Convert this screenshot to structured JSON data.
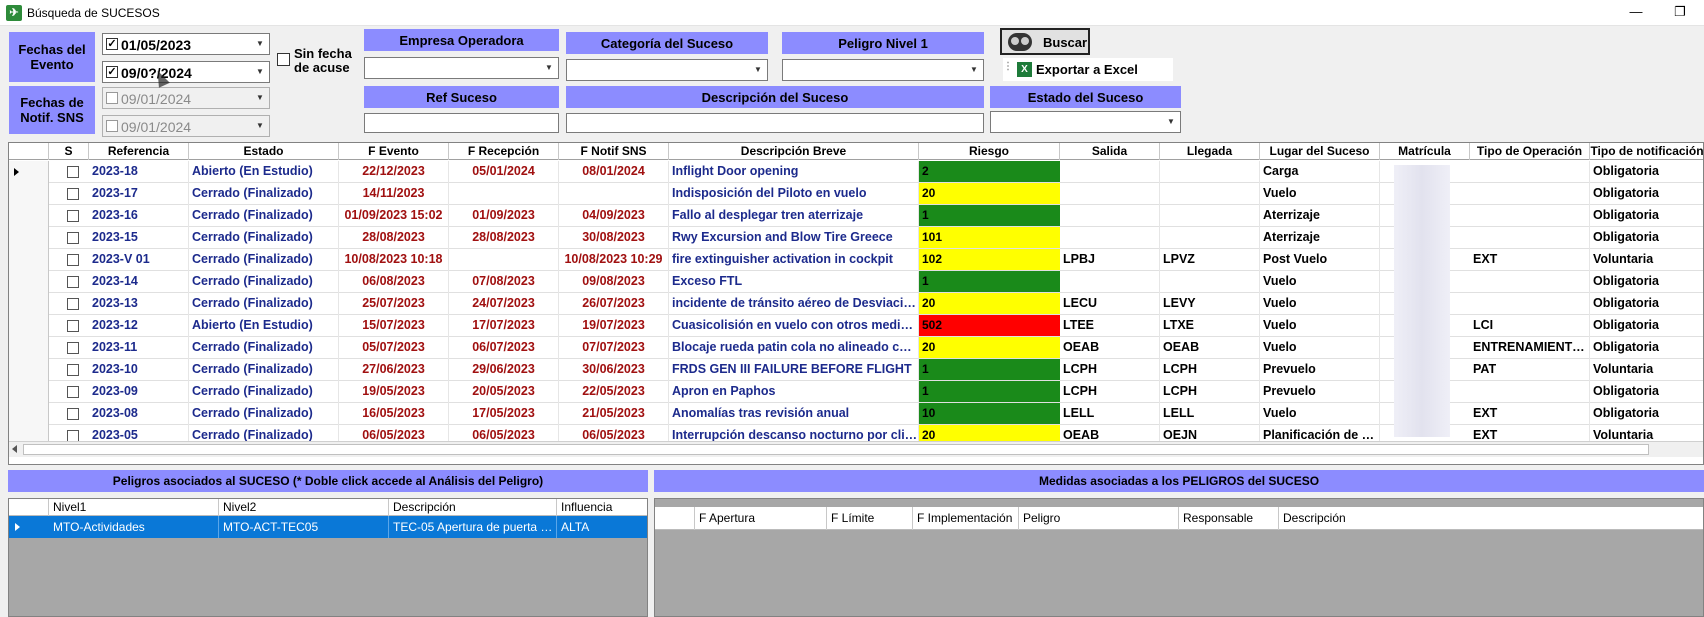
{
  "window": {
    "title": "Búsqueda de SUCESOS",
    "app_icon": "airplane-icon",
    "minimize": "—",
    "restore": "❐"
  },
  "filters": {
    "fechas_evento_label": "Fechas del Evento",
    "fechas_notif_label": "Fechas de Notif. SNS",
    "evento_desde": "01/05/2023",
    "evento_hasta": "09/0?/2024",
    "notif_desde": "09/01/2024",
    "notif_hasta": "09/01/2024",
    "sin_fecha_acuse": "Sin fecha de acuse",
    "empresa_operadora": "Empresa Operadora",
    "categoria_suceso": "Categoría del Suceso",
    "peligro_nivel1": "Peligro Nivel 1",
    "ref_suceso": "Ref Suceso",
    "descripcion_suceso": "Descripción del Suceso",
    "estado_suceso": "Estado del Suceso",
    "buscar": "Buscar",
    "exportar_excel": "Exportar a Excel"
  },
  "colors": {
    "accent": "#8c8cff",
    "riesgo_green": "#1a8a1a",
    "riesgo_yellow": "#ffff00",
    "riesgo_red": "#ff0000",
    "selected_row": "#0a78d7"
  },
  "grid": {
    "columns": [
      "S",
      "Referencia",
      "Estado",
      "F Evento",
      "F Recepción",
      "F Notif SNS",
      "Descripción Breve",
      "Riesgo",
      "Salida",
      "Llegada",
      "Lugar del Suceso",
      "Matrícula",
      "Tipo de Operación",
      "Tipo de notificación"
    ],
    "rows": [
      {
        "ref": "2023-18",
        "estado": "Abierto (En Estudio)",
        "f_evento": "22/12/2023",
        "f_recepcion": "05/01/2024",
        "f_notif": "08/01/2024",
        "descripcion": "Inflight Door opening",
        "riesgo": "2",
        "riesgo_color": "green",
        "salida": "",
        "llegada": "",
        "lugar": "Carga",
        "tipo_op": "",
        "tipo_notif": "Obligatoria"
      },
      {
        "ref": "2023-17",
        "estado": "Cerrado (Finalizado)",
        "f_evento": "14/11/2023",
        "f_recepcion": "",
        "f_notif": "",
        "descripcion": "Indisposición del Piloto en vuelo",
        "riesgo": "20",
        "riesgo_color": "yellow",
        "salida": "",
        "llegada": "",
        "lugar": "Vuelo",
        "tipo_op": "",
        "tipo_notif": "Obligatoria"
      },
      {
        "ref": "2023-16",
        "estado": "Cerrado (Finalizado)",
        "f_evento": "01/09/2023 15:02",
        "f_recepcion": "01/09/2023",
        "f_notif": "04/09/2023",
        "descripcion": "Fallo al desplegar tren aterrizaje",
        "riesgo": "1",
        "riesgo_color": "green",
        "salida": "",
        "llegada": "",
        "lugar": "Aterrizaje",
        "tipo_op": "",
        "tipo_notif": "Obligatoria"
      },
      {
        "ref": "2023-15",
        "estado": "Cerrado (Finalizado)",
        "f_evento": "28/08/2023",
        "f_recepcion": "28/08/2023",
        "f_notif": "30/08/2023",
        "descripcion": "Rwy Excursion and Blow Tire Greece",
        "riesgo": "101",
        "riesgo_color": "yellow",
        "salida": "",
        "llegada": "",
        "lugar": "Aterrizaje",
        "tipo_op": "",
        "tipo_notif": "Obligatoria"
      },
      {
        "ref": "2023-V 01",
        "estado": "Cerrado (Finalizado)",
        "f_evento": "10/08/2023 10:18",
        "f_recepcion": "",
        "f_notif": "10/08/2023 10:29",
        "descripcion": "fire extinguisher activation in cockpit",
        "riesgo": "102",
        "riesgo_color": "yellow",
        "salida": "LPBJ",
        "llegada": "LPVZ",
        "lugar": "Post Vuelo",
        "tipo_op": "EXT",
        "tipo_notif": "Voluntaria"
      },
      {
        "ref": "2023-14",
        "estado": "Cerrado (Finalizado)",
        "f_evento": "06/08/2023",
        "f_recepcion": "07/08/2023",
        "f_notif": "09/08/2023",
        "descripcion": "Exceso FTL",
        "riesgo": "1",
        "riesgo_color": "green",
        "salida": "",
        "llegada": "",
        "lugar": "Vuelo",
        "tipo_op": "",
        "tipo_notif": "Obligatoria"
      },
      {
        "ref": "2023-13",
        "estado": "Cerrado (Finalizado)",
        "f_evento": "25/07/2023",
        "f_recepcion": "24/07/2023",
        "f_notif": "26/07/2023",
        "descripcion": "incidente de tránsito aéreo de Desviació...",
        "riesgo": "20",
        "riesgo_color": "yellow",
        "salida": "LECU",
        "llegada": "LEVY",
        "lugar": "Vuelo",
        "tipo_op": "",
        "tipo_notif": "Obligatoria"
      },
      {
        "ref": "2023-12",
        "estado": "Abierto (En Estudio)",
        "f_evento": "15/07/2023",
        "f_recepcion": "17/07/2023",
        "f_notif": "19/07/2023",
        "descripcion": "Cuasicolisión en vuelo con otros medios ...",
        "riesgo": "502",
        "riesgo_color": "red",
        "salida": "LTEE",
        "llegada": "LTXE",
        "lugar": "Vuelo",
        "tipo_op": "LCI",
        "tipo_notif": "Obligatoria"
      },
      {
        "ref": "2023-11",
        "estado": "Cerrado (Finalizado)",
        "f_evento": "05/07/2023",
        "f_recepcion": "06/07/2023",
        "f_notif": "07/07/2023",
        "descripcion": "Blocaje rueda patin cola no alineado con ...",
        "riesgo": "20",
        "riesgo_color": "yellow",
        "salida": "OEAB",
        "llegada": "OEAB",
        "lugar": "Vuelo",
        "tipo_op": "ENTRENAMIENTO ...",
        "tipo_notif": "Obligatoria"
      },
      {
        "ref": "2023-10",
        "estado": "Cerrado (Finalizado)",
        "f_evento": "27/06/2023",
        "f_recepcion": "29/06/2023",
        "f_notif": "30/06/2023",
        "descripcion": "FRDS GEN III FAILURE BEFORE FLIGHT",
        "riesgo": "1",
        "riesgo_color": "green",
        "salida": "LCPH",
        "llegada": "LCPH",
        "lugar": "Prevuelo",
        "tipo_op": "PAT",
        "tipo_notif": "Voluntaria"
      },
      {
        "ref": "2023-09",
        "estado": "Cerrado (Finalizado)",
        "f_evento": "19/05/2023",
        "f_recepcion": "20/05/2023",
        "f_notif": "22/05/2023",
        "descripcion": "Apron en Paphos",
        "riesgo": "1",
        "riesgo_color": "green",
        "salida": "LCPH",
        "llegada": "LCPH",
        "lugar": "Prevuelo",
        "tipo_op": "",
        "tipo_notif": "Obligatoria"
      },
      {
        "ref": "2023-08",
        "estado": "Cerrado (Finalizado)",
        "f_evento": "16/05/2023",
        "f_recepcion": "17/05/2023",
        "f_notif": "21/05/2023",
        "descripcion": "Anomalías tras revisión anual",
        "riesgo": "10",
        "riesgo_color": "green",
        "salida": "LELL",
        "llegada": "LELL",
        "lugar": "Vuelo",
        "tipo_op": "EXT",
        "tipo_notif": "Obligatoria"
      },
      {
        "ref": "2023-05",
        "estado": "Cerrado (Finalizado)",
        "f_evento": "06/05/2023",
        "f_recepcion": "06/05/2023",
        "f_notif": "06/05/2023",
        "descripcion": "Interrupción descanso nocturno por clie...",
        "riesgo": "20",
        "riesgo_color": "yellow",
        "salida": "OEAB",
        "llegada": "OEJN",
        "lugar": "Planificación de V...",
        "tipo_op": "EXT",
        "tipo_notif": "Voluntaria"
      }
    ]
  },
  "peligros": {
    "title": "Peligros asociados al SUCESO (* Doble click accede al Análisis del Peligro)",
    "columns": [
      "Nivel1",
      "Nivel2",
      "Descripción",
      "Influencia"
    ],
    "rows": [
      {
        "nivel1": "MTO-Actividades",
        "nivel2": "MTO-ACT-TEC05",
        "descripcion": "TEC-05 Apertura de puerta en o...",
        "influencia": "ALTA"
      }
    ]
  },
  "medidas": {
    "title": "Medidas asociadas a los PELIGROS del SUCESO",
    "columns": [
      "F Apertura",
      "F Límite",
      "F Implementación",
      "Peligro",
      "Responsable",
      "Descripción"
    ]
  }
}
